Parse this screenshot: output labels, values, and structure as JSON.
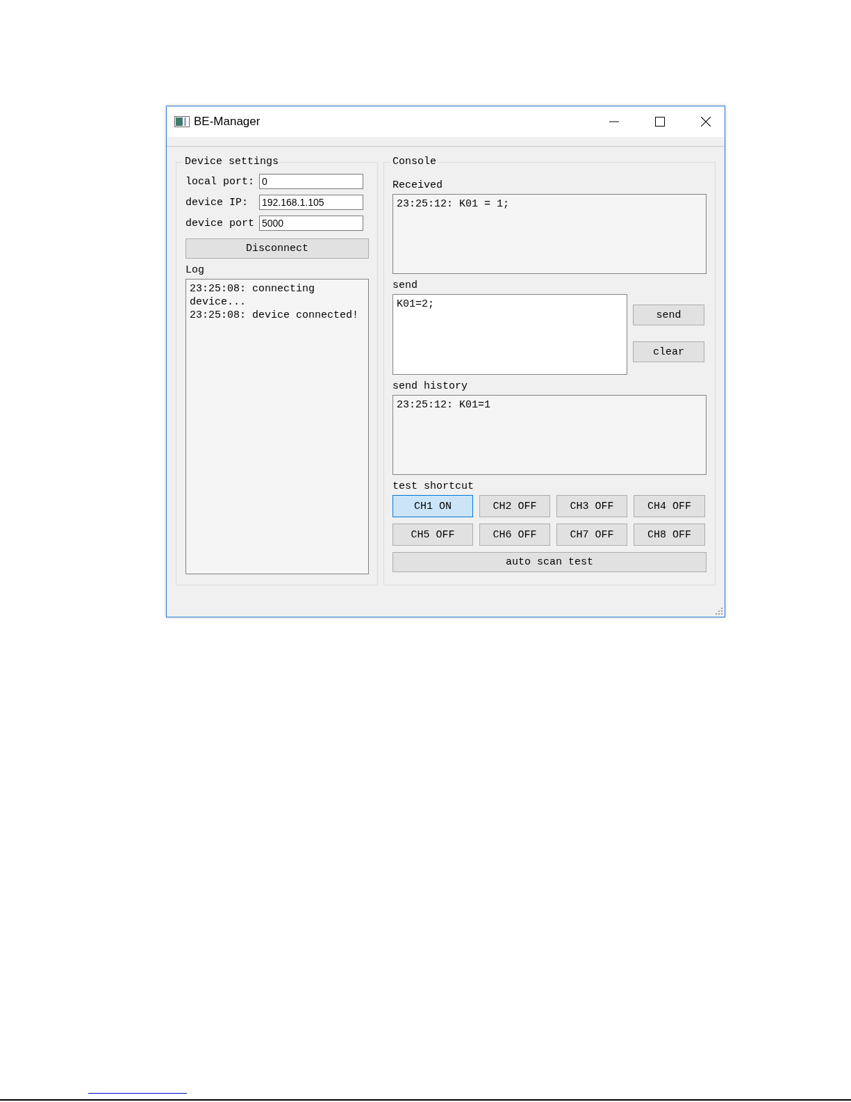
{
  "window": {
    "title": "BE-Manager"
  },
  "device_settings": {
    "title": "Device settings",
    "fields": [
      {
        "label": "local port:",
        "value": "0"
      },
      {
        "label": "device IP:",
        "value": "192.168.1.105"
      },
      {
        "label": "device port",
        "value": "5000"
      }
    ],
    "connect_button": "Disconnect",
    "log": {
      "label": "Log",
      "lines": [
        "23:25:08: connecting device...",
        "23:25:08: device connected!"
      ]
    }
  },
  "console": {
    "title": "Console",
    "received": {
      "label": "Received",
      "lines": [
        "23:25:12: K01 = 1;"
      ]
    },
    "send": {
      "label": "send",
      "value": "K01=2;",
      "buttons": [
        "send",
        "clear"
      ]
    },
    "send_history": {
      "label": "send history",
      "lines": [
        "23:25:12: K01=1"
      ]
    },
    "test_shortcut": {
      "label": "test shortcut",
      "channels": [
        {
          "label": "CH1 ON",
          "selected": true
        },
        {
          "label": "CH2 OFF",
          "selected": false
        },
        {
          "label": "CH3 OFF",
          "selected": false
        },
        {
          "label": "CH4 OFF",
          "selected": false
        },
        {
          "label": "CH5 OFF",
          "selected": false
        },
        {
          "label": "CH6 OFF",
          "selected": false
        },
        {
          "label": "CH7 OFF",
          "selected": false
        },
        {
          "label": "CH8 OFF",
          "selected": false
        }
      ],
      "auto_button": "auto scan test"
    }
  }
}
